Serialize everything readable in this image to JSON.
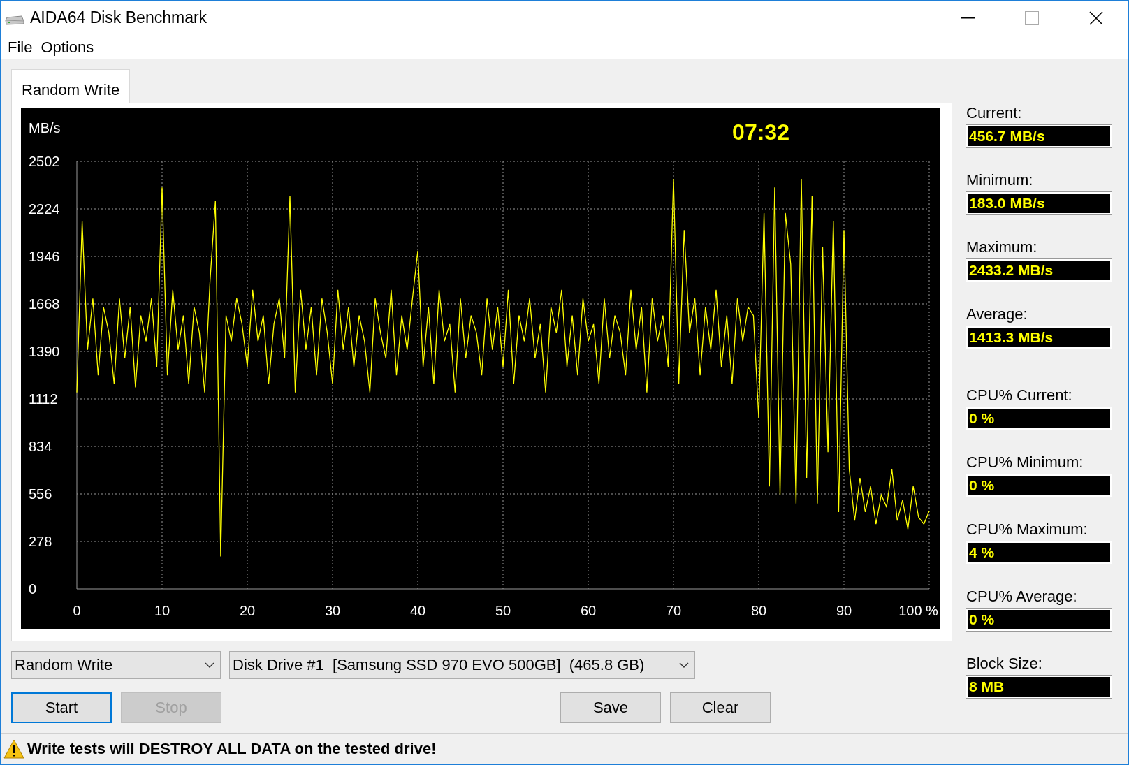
{
  "window": {
    "title": "AIDA64 Disk Benchmark"
  },
  "menu": [
    "File",
    "Options"
  ],
  "tabs": [
    {
      "label": "Random Write",
      "selected": true
    }
  ],
  "graph": {
    "timer": "07:32",
    "chart_data": {
      "type": "line",
      "ylabel": "MB/s",
      "grid": true,
      "xlim": [
        0,
        100
      ],
      "ylim": [
        0,
        2502
      ],
      "x": [
        0,
        0.625,
        1.25,
        1.875,
        2.5,
        3.125,
        3.75,
        4.375,
        5,
        5.625,
        6.25,
        6.875,
        7.5,
        8.125,
        8.75,
        9.375,
        10,
        10.625,
        11.25,
        11.875,
        12.5,
        13.125,
        13.75,
        14.375,
        15,
        15.625,
        16.25,
        16.875,
        17.5,
        18.125,
        18.75,
        19.375,
        20,
        20.625,
        21.25,
        21.875,
        22.5,
        23.125,
        23.75,
        24.375,
        25,
        25.625,
        26.25,
        26.875,
        27.5,
        28.125,
        28.75,
        29.375,
        30,
        30.625,
        31.25,
        31.875,
        32.5,
        33.125,
        33.75,
        34.375,
        35,
        35.625,
        36.25,
        36.875,
        37.5,
        38.125,
        38.75,
        39.375,
        40,
        40.625,
        41.25,
        41.875,
        42.5,
        43.125,
        43.75,
        44.375,
        45,
        45.625,
        46.25,
        46.875,
        47.5,
        48.125,
        48.75,
        49.375,
        50,
        50.625,
        51.25,
        51.875,
        52.5,
        53.125,
        53.75,
        54.375,
        55,
        55.625,
        56.25,
        56.875,
        57.5,
        58.125,
        58.75,
        59.375,
        60,
        60.625,
        61.25,
        61.875,
        62.5,
        63.125,
        63.75,
        64.375,
        65,
        65.625,
        66.25,
        66.875,
        67.5,
        68.125,
        68.75,
        69.375,
        70,
        70.625,
        71.25,
        71.875,
        72.5,
        73.125,
        73.75,
        74.375,
        75,
        75.625,
        76.25,
        76.875,
        77.5,
        78.125,
        78.75,
        79.375,
        80,
        80.625,
        81.25,
        81.875,
        82.5,
        83.125,
        83.75,
        84.375,
        85,
        85.625,
        86.25,
        86.875,
        87.5,
        88.125,
        88.75,
        89.375,
        90,
        90.625,
        91.25,
        91.875,
        92.5,
        93.125,
        93.75,
        94.375,
        95,
        95.625,
        96.25,
        96.875,
        97.5,
        98.125,
        98.75,
        99.375,
        100
      ],
      "yticks": [
        2502,
        2224,
        1946,
        1668,
        1390,
        1112,
        834,
        556,
        278,
        0
      ],
      "xticks": [
        0,
        10,
        20,
        30,
        40,
        50,
        60,
        70,
        80,
        90,
        {
          "value": 100,
          "label": "100 %"
        }
      ],
      "series": [
        {
          "color": "#ffff00",
          "values": [
            1150,
            2150,
            1400,
            1700,
            1250,
            1650,
            1500,
            1200,
            1700,
            1350,
            1650,
            1180,
            1600,
            1450,
            1700,
            1300,
            2350,
            1250,
            1750,
            1400,
            1600,
            1200,
            1650,
            1500,
            1150,
            1800,
            2270,
            190,
            1600,
            1450,
            1700,
            1550,
            1300,
            1750,
            1450,
            1600,
            1200,
            1550,
            1700,
            1350,
            2300,
            1150,
            1750,
            1400,
            1650,
            1250,
            1700,
            1500,
            1200,
            1750,
            1400,
            1650,
            1300,
            1600,
            1450,
            1150,
            1700,
            1500,
            1350,
            1750,
            1250,
            1600,
            1400,
            1700,
            1980,
            1300,
            1650,
            1200,
            1750,
            1450,
            1550,
            1150,
            1700,
            1350,
            1600,
            1500,
            1250,
            1700,
            1400,
            1650,
            1300,
            1750,
            1200,
            1600,
            1450,
            1700,
            1350,
            1550,
            1150,
            1650,
            1500,
            1750,
            1300,
            1600,
            1250,
            1700,
            1450,
            1550,
            1200,
            1700,
            1350,
            1600,
            1500,
            1250,
            1750,
            1400,
            1650,
            1150,
            1700,
            1450,
            1600,
            1300,
            2400,
            1200,
            2100,
            1500,
            1700,
            1250,
            1650,
            1400,
            1750,
            1300,
            1600,
            1200,
            1700,
            1450,
            1650,
            1600,
            1000,
            2200,
            600,
            2350,
            550,
            2200,
            1900,
            500,
            2400,
            650,
            2300,
            500,
            2000,
            800,
            2150,
            450,
            2100,
            700,
            400,
            650,
            450,
            600,
            380,
            550,
            480,
            700,
            400,
            520,
            350,
            600,
            420,
            380,
            456
          ]
        }
      ]
    }
  },
  "stats": [
    {
      "label": "Current:",
      "value": "456.7 MB/s"
    },
    {
      "label": "Minimum:",
      "value": "183.0 MB/s"
    },
    {
      "label": "Maximum:",
      "value": "2433.2 MB/s"
    },
    {
      "label": "Average:",
      "value": "1413.3 MB/s"
    },
    {
      "label": "CPU% Current:",
      "value": "0 %"
    },
    {
      "label": "CPU% Minimum:",
      "value": "0 %"
    },
    {
      "label": "CPU% Maximum:",
      "value": "4 %"
    },
    {
      "label": "CPU% Average:",
      "value": "0 %"
    },
    {
      "label": "Block Size:",
      "value": "8 MB"
    }
  ],
  "test_select": {
    "value": "Random Write"
  },
  "drive_select": {
    "value": "Disk Drive #1  [Samsung SSD 970 EVO 500GB]  (465.8 GB)"
  },
  "buttons": [
    {
      "label": "Start",
      "disabled": false,
      "focused": true
    },
    {
      "label": "Stop",
      "disabled": true,
      "focused": false
    },
    {
      "label": "Save",
      "disabled": false,
      "focused": false
    },
    {
      "label": "Clear",
      "disabled": false,
      "focused": false
    }
  ],
  "status_bar": {
    "text": "Write tests will DESTROY ALL DATA on the tested drive!"
  }
}
